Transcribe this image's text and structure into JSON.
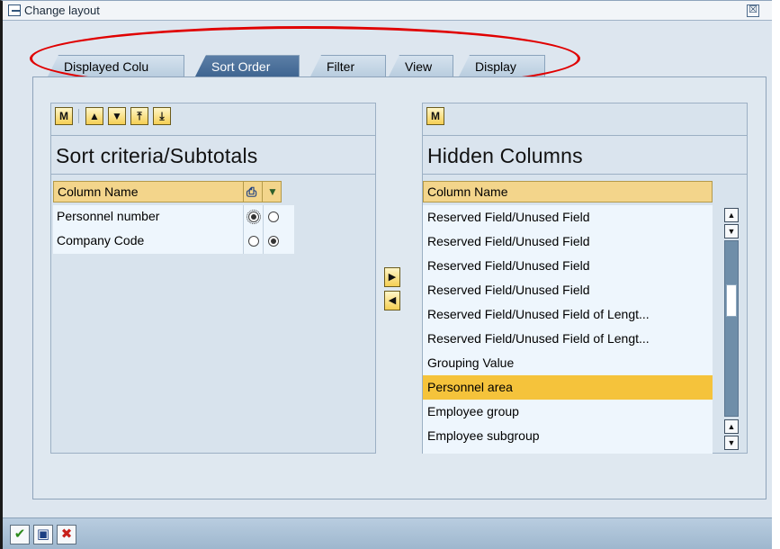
{
  "window": {
    "title": "Change layout",
    "close_symbol": "☒"
  },
  "tabs": [
    {
      "label": "Displayed Colu",
      "active": false
    },
    {
      "label": "Sort Order",
      "active": true
    },
    {
      "label": "Filter",
      "active": false
    },
    {
      "label": "View",
      "active": false
    },
    {
      "label": "Display",
      "active": false
    }
  ],
  "left_panel": {
    "title": "Sort criteria/Subtotals",
    "toolbar_icons": [
      "find-icon",
      "move-up-icon",
      "move-down-icon",
      "move-top-icon",
      "move-bottom-icon"
    ],
    "toolbar_glyphs": [
      "M",
      "▲",
      "▼",
      "⤒",
      "⤓"
    ],
    "column_header": "Column Name",
    "header_icons": [
      "print-icon",
      "subtotal-icon"
    ],
    "header_glyphs": [
      "⎙",
      "▼"
    ],
    "rows": [
      {
        "name": "Personnel number",
        "ascending_selected": true,
        "descending_selected": false
      },
      {
        "name": "Company Code",
        "ascending_selected": false,
        "descending_selected": true
      }
    ]
  },
  "transfer": {
    "right_glyph": "▶",
    "left_glyph": "◀"
  },
  "right_panel": {
    "title": "Hidden Columns",
    "toolbar_glyph": "M",
    "column_header": "Column Name",
    "items": [
      "Reserved Field/Unused Field",
      "Reserved Field/Unused Field",
      "Reserved Field/Unused Field",
      "Reserved Field/Unused Field",
      "Reserved Field/Unused Field of Lengt...",
      "Reserved Field/Unused Field of Lengt...",
      "Grouping Value",
      "Personnel area",
      "Employee group",
      "Employee subgroup"
    ],
    "highlighted_item": "Personnel area",
    "scroll_glyphs": {
      "up": "▲",
      "down": "▼"
    }
  },
  "bottom_bar": {
    "buttons": [
      {
        "name": "confirm",
        "glyph": "✔",
        "color": "#2c8a1b"
      },
      {
        "name": "save",
        "glyph": "▣",
        "color": "#1d3f82"
      },
      {
        "name": "cancel",
        "glyph": "✖",
        "color": "#c8201a"
      }
    ]
  },
  "colors": {
    "accent_active_tab": "#3f6591",
    "highlight": "#f5c33b",
    "annotation_ellipse": "#e00000"
  }
}
